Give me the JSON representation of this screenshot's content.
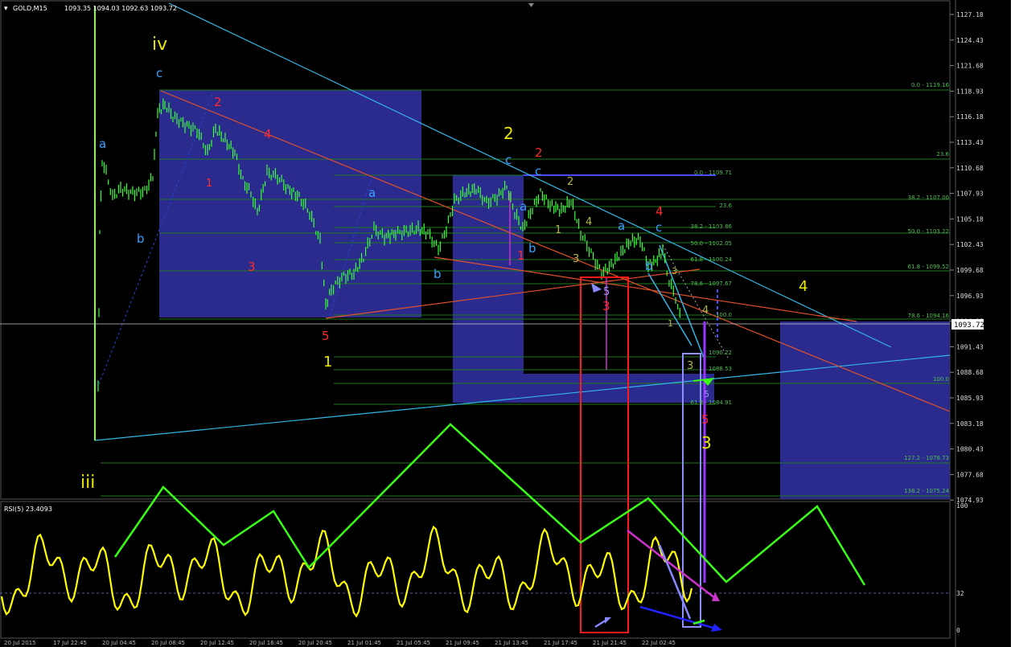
{
  "window": {
    "symbol_header": "GOLD,M15",
    "quotes": "1093.35 1094.03 1092.63 1093.72",
    "current_price": "1093.72"
  },
  "price_scale": [
    "1127.18",
    "1124.43",
    "1121.68",
    "1118.93",
    "1116.18",
    "1113.43",
    "1110.68",
    "1107.93",
    "1105.18",
    "1102.43",
    "1099.68",
    "1096.93",
    "1094.18",
    "1091.43",
    "1088.68",
    "1085.93",
    "1083.18",
    "1080.43",
    "1077.68",
    "1074.93"
  ],
  "rsi_scale": [
    "100",
    "32",
    "0"
  ],
  "rsi_header": "RSI(5) 23.4093",
  "fib_labels": [
    "0.0 - 1119.16",
    "23.6",
    "38.2 - 1107.00",
    "50.0 - 1103.22",
    "61.8 - 1099.52",
    "78.6 - 1094.16",
    "0.0 - 1109.71",
    "23.6",
    "38.2 - 1103.86",
    "50.0 - 1102.05",
    "61.8 - 1100.24",
    "78.6 - 1097.67",
    "100.0",
    "1090.22",
    "1088.53",
    "100.0",
    "61.8 - 1084.91",
    "127.2 - 1078.73",
    "138.2 - 1075.24"
  ],
  "time_axis": [
    "20 Jul 2015",
    "17 Jul 22:45",
    "20 Jul 04:45",
    "20 Jul 08:45",
    "20 Jul 12:45",
    "20 Jul 16:45",
    "20 Jul 20:45",
    "21 Jul 01:45",
    "21 Jul 05:45",
    "21 Jul 09:45",
    "21 Jul 13:45",
    "21 Jul 17:45",
    "21 Jul 21:45",
    "22 Jul 02:45"
  ],
  "wave_labels": [
    {
      "t": "iv",
      "c": "#e8e800"
    },
    {
      "t": "c",
      "c": "#3aa0ff"
    },
    {
      "t": "a",
      "c": "#3aa0ff"
    },
    {
      "t": "b",
      "c": "#3aa0ff"
    },
    {
      "t": "2",
      "c": "#ff2a2a"
    },
    {
      "t": "1",
      "c": "#ff2a2a"
    },
    {
      "t": "4",
      "c": "#ff2a2a"
    },
    {
      "t": "3",
      "c": "#ff2a2a"
    },
    {
      "t": "5",
      "c": "#ff2a2a"
    },
    {
      "t": "1",
      "c": "#e8e800"
    },
    {
      "t": "a",
      "c": "#3aa0ff"
    },
    {
      "t": "b",
      "c": "#3aa0ff"
    },
    {
      "t": "2",
      "c": "#e8e800"
    },
    {
      "t": "c",
      "c": "#3aa0ff"
    },
    {
      "t": "2",
      "c": "#ff2a2a"
    },
    {
      "t": "c",
      "c": "#3aa0ff"
    },
    {
      "t": "a",
      "c": "#3aa0ff"
    },
    {
      "t": "b",
      "c": "#3aa0ff"
    },
    {
      "t": "1",
      "c": "#ff2a2a"
    },
    {
      "t": "2",
      "c": "#b5b54a"
    },
    {
      "t": "1",
      "c": "#b5b54a"
    },
    {
      "t": "4",
      "c": "#b5b54a"
    },
    {
      "t": "3",
      "c": "#b5b54a"
    },
    {
      "t": "5",
      "c": "#9999ff"
    },
    {
      "t": "3",
      "c": "#ff2a2a"
    },
    {
      "t": "a",
      "c": "#3aa0ff"
    },
    {
      "t": "4",
      "c": "#ff2a2a"
    },
    {
      "t": "c",
      "c": "#3aa0ff"
    },
    {
      "t": "b",
      "c": "#3aa0ff"
    },
    {
      "t": "3",
      "c": "#b5b54a"
    },
    {
      "t": "4",
      "c": "#b5b54a"
    },
    {
      "t": "1",
      "c": "#b5b54a"
    },
    {
      "t": "3",
      "c": "#b5b54a"
    },
    {
      "t": "5",
      "c": "#9999ff"
    },
    {
      "t": "5",
      "c": "#ff2a2a"
    },
    {
      "t": "3",
      "c": "#e8e800"
    },
    {
      "t": "4",
      "c": "#e8e800"
    },
    {
      "t": "iii",
      "c": "#e8e800"
    }
  ],
  "colors": {
    "background": "#000000",
    "grid": "#2a2a2a",
    "candles": "#3cff3c",
    "zones": "#2b2b8e",
    "trend_cyan": "#33b5e5",
    "trend_orange": "#e0502a",
    "rsi": "#ffff00",
    "arrows": "#39ff14"
  }
}
